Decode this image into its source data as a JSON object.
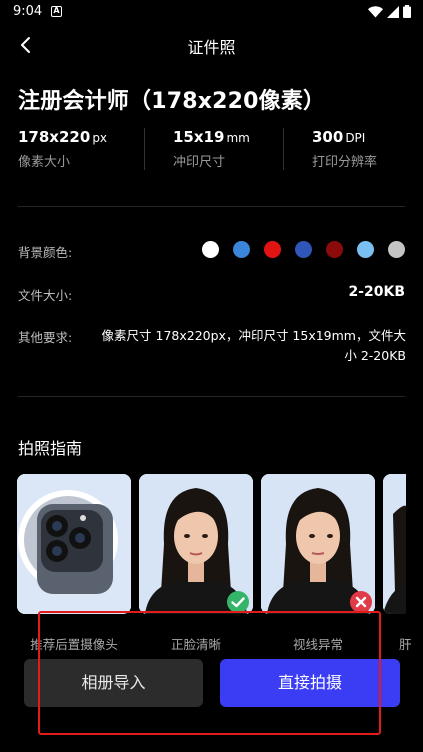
{
  "status_bar": {
    "time": "9:04",
    "notification_badge": "A"
  },
  "header": {
    "title": "证件照"
  },
  "spec": {
    "title": "注册会计师（178x220像素）"
  },
  "stats": [
    {
      "value": "178x220",
      "unit": "px",
      "label": "像素大小"
    },
    {
      "value": "15x19",
      "unit": "mm",
      "label": "冲印尺寸"
    },
    {
      "value": "300",
      "unit": "DPI",
      "label": "打印分辨率"
    }
  ],
  "details": {
    "bg_label": "背景颜色:",
    "bg_colors": [
      "#ffffff",
      "#3b86d8",
      "#e11414",
      "#2f56b8",
      "#8b0a0a",
      "#79bff2",
      "#c4c4c4"
    ],
    "size_label": "文件大小:",
    "size_value": "2-20KB",
    "other_label": "其他要求:",
    "other_value": "像素尺寸 178x220px，冲印尺寸 15x19mm，文件大小 2-20KB"
  },
  "guide": {
    "title": "拍照指南",
    "cards": [
      {
        "label": "推荐后置摄像头",
        "badge": "none"
      },
      {
        "label": "正脸清晰",
        "badge": "check"
      },
      {
        "label": "视线异常",
        "badge": "cross"
      },
      {
        "label": "肝",
        "badge": "none"
      }
    ]
  },
  "actions": {
    "album": "相册导入",
    "shoot": "直接拍摄"
  }
}
